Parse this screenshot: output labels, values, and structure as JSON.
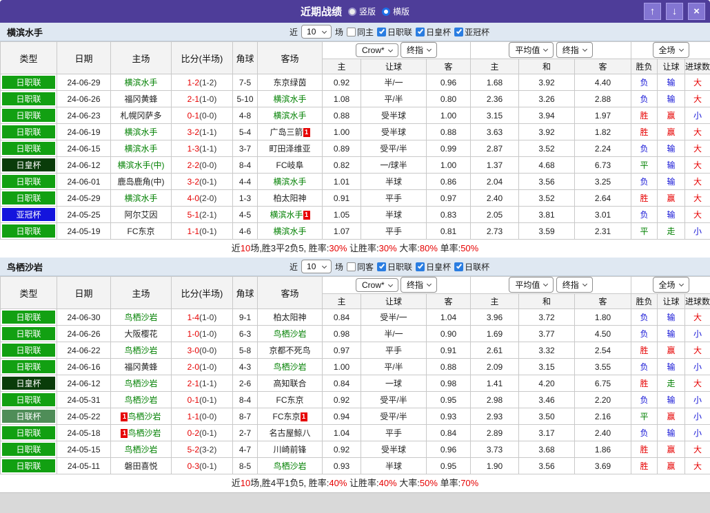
{
  "titlebar": {
    "title": "近期战绩",
    "radios": [
      {
        "label": "竖版",
        "selected": false
      },
      {
        "label": "横版",
        "selected": true
      }
    ],
    "buttons": {
      "up": "↑",
      "down": "↓",
      "close": "×"
    }
  },
  "labels": {
    "near": "近",
    "games": "场"
  },
  "badge_label": "1",
  "columns": {
    "main": [
      "类型",
      "日期",
      "主场",
      "比分(半场)",
      "角球",
      "客场"
    ],
    "g1": [
      "Crow*",
      "终指"
    ],
    "g2": [
      "平均值",
      "终指"
    ],
    "g3": [
      "全场"
    ],
    "sub": [
      "主",
      "让球",
      "客",
      "主",
      "和",
      "客",
      "胜负",
      "让球",
      "进球数"
    ]
  },
  "type_colors": {
    "日职联": "#12a012",
    "日皇杯": "#0a3c0a",
    "亚冠杯": "#1414dd",
    "日联杯": "#4f8d58"
  },
  "result_colors": {
    "胜": "#e60000",
    "赢": "#e60000",
    "大": "#e60000",
    "平": "#008000",
    "走": "#008000",
    "负": "#1414d6",
    "输": "#1414d6",
    "小": "#1414d6"
  },
  "sections": [
    {
      "team": "横滨水手",
      "filter": {
        "count": "10",
        "same_label": "同主",
        "same_checked": false,
        "leagues": [
          {
            "label": "日职联",
            "checked": true
          },
          {
            "label": "日皇杯",
            "checked": true
          },
          {
            "label": "亚冠杯",
            "checked": true
          }
        ]
      },
      "rows": [
        {
          "type": "日职联",
          "date": "24-06-29",
          "home": {
            "n": "横滨水手",
            "g": true
          },
          "score": "1-2",
          "half": "(1-2)",
          "corner": "7-5",
          "away": {
            "n": "东京绿茵"
          },
          "o1": [
            "0.92",
            "半/一",
            "0.96"
          ],
          "o2": [
            "1.68",
            "3.92",
            "4.40"
          ],
          "res": [
            "负",
            "输",
            "大"
          ]
        },
        {
          "type": "日职联",
          "date": "24-06-26",
          "home": {
            "n": "福冈黄蜂"
          },
          "score": "2-1",
          "half": "(1-0)",
          "corner": "5-10",
          "away": {
            "n": "横滨水手",
            "g": true
          },
          "o1": [
            "1.08",
            "平/半",
            "0.80"
          ],
          "o2": [
            "2.36",
            "3.26",
            "2.88"
          ],
          "res": [
            "负",
            "输",
            "大"
          ]
        },
        {
          "type": "日职联",
          "date": "24-06-23",
          "home": {
            "n": "札幌冈萨多"
          },
          "score": "0-1",
          "half": "(0-0)",
          "corner": "4-8",
          "away": {
            "n": "横滨水手",
            "g": true
          },
          "o1": [
            "0.88",
            "受半球",
            "1.00"
          ],
          "o2": [
            "3.15",
            "3.94",
            "1.97"
          ],
          "res": [
            "胜",
            "赢",
            "小"
          ]
        },
        {
          "type": "日职联",
          "date": "24-06-19",
          "home": {
            "n": "横滨水手",
            "g": true
          },
          "score": "3-2",
          "half": "(1-1)",
          "corner": "5-4",
          "away": {
            "n": "广岛三箭",
            "badge": "after"
          },
          "o1": [
            "1.00",
            "受半球",
            "0.88"
          ],
          "o2": [
            "3.63",
            "3.92",
            "1.82"
          ],
          "res": [
            "胜",
            "赢",
            "大"
          ]
        },
        {
          "type": "日职联",
          "date": "24-06-15",
          "home": {
            "n": "横滨水手",
            "g": true
          },
          "score": "1-3",
          "half": "(1-1)",
          "corner": "3-7",
          "away": {
            "n": "町田泽维亚"
          },
          "o1": [
            "0.89",
            "受平/半",
            "0.99"
          ],
          "o2": [
            "2.87",
            "3.52",
            "2.24"
          ],
          "res": [
            "负",
            "输",
            "大"
          ]
        },
        {
          "type": "日皇杯",
          "date": "24-06-12",
          "home": {
            "n": "横滨水手(中)",
            "g": true
          },
          "score": "2-2",
          "half": "(0-0)",
          "corner": "8-4",
          "away": {
            "n": "FC岐阜"
          },
          "o1": [
            "0.82",
            "一/球半",
            "1.00"
          ],
          "o2": [
            "1.37",
            "4.68",
            "6.73"
          ],
          "res": [
            "平",
            "输",
            "大"
          ]
        },
        {
          "type": "日职联",
          "date": "24-06-01",
          "home": {
            "n": "鹿岛鹿角(中)"
          },
          "score": "3-2",
          "half": "(0-1)",
          "corner": "4-4",
          "away": {
            "n": "横滨水手",
            "g": true
          },
          "o1": [
            "1.01",
            "半球",
            "0.86"
          ],
          "o2": [
            "2.04",
            "3.56",
            "3.25"
          ],
          "res": [
            "负",
            "输",
            "大"
          ]
        },
        {
          "type": "日职联",
          "date": "24-05-29",
          "home": {
            "n": "横滨水手",
            "g": true
          },
          "score": "4-0",
          "half": "(2-0)",
          "corner": "1-3",
          "away": {
            "n": "柏太阳神"
          },
          "o1": [
            "0.91",
            "平手",
            "0.97"
          ],
          "o2": [
            "2.40",
            "3.52",
            "2.64"
          ],
          "res": [
            "胜",
            "赢",
            "大"
          ]
        },
        {
          "type": "亚冠杯",
          "date": "24-05-25",
          "home": {
            "n": "阿尔艾因"
          },
          "score": "5-1",
          "half": "(2-1)",
          "corner": "4-5",
          "away": {
            "n": "横滨水手",
            "g": true,
            "badge": "after"
          },
          "o1": [
            "1.05",
            "半球",
            "0.83"
          ],
          "o2": [
            "2.05",
            "3.81",
            "3.01"
          ],
          "res": [
            "负",
            "输",
            "大"
          ]
        },
        {
          "type": "日职联",
          "date": "24-05-19",
          "home": {
            "n": "FC东京"
          },
          "score": "1-1",
          "half": "(0-1)",
          "corner": "4-6",
          "away": {
            "n": "横滨水手",
            "g": true
          },
          "o1": [
            "1.07",
            "平手",
            "0.81"
          ],
          "o2": [
            "2.73",
            "3.59",
            "2.31"
          ],
          "res": [
            "平",
            "走",
            "小"
          ]
        }
      ],
      "summary": [
        {
          "t": "近"
        },
        {
          "t": "10",
          "r": true
        },
        {
          "t": "场,胜3平2负5, 胜率:"
        },
        {
          "t": "30%",
          "r": true
        },
        {
          "t": " 让胜率:"
        },
        {
          "t": "30%",
          "r": true
        },
        {
          "t": " 大率:"
        },
        {
          "t": "80%",
          "r": true
        },
        {
          "t": " 单率:"
        },
        {
          "t": "50%",
          "r": true
        }
      ]
    },
    {
      "team": "鸟栖沙岩",
      "filter": {
        "count": "10",
        "same_label": "同客",
        "same_checked": false,
        "leagues": [
          {
            "label": "日职联",
            "checked": true
          },
          {
            "label": "日皇杯",
            "checked": true
          },
          {
            "label": "日联杯",
            "checked": true
          }
        ]
      },
      "rows": [
        {
          "type": "日职联",
          "date": "24-06-30",
          "home": {
            "n": "鸟栖沙岩",
            "g": true
          },
          "score": "1-4",
          "half": "(1-0)",
          "corner": "9-1",
          "away": {
            "n": "柏太阳神"
          },
          "o1": [
            "0.84",
            "受半/一",
            "1.04"
          ],
          "o2": [
            "3.96",
            "3.72",
            "1.80"
          ],
          "res": [
            "负",
            "输",
            "大"
          ]
        },
        {
          "type": "日职联",
          "date": "24-06-26",
          "home": {
            "n": "大阪樱花"
          },
          "score": "1-0",
          "half": "(1-0)",
          "corner": "6-3",
          "away": {
            "n": "鸟栖沙岩",
            "g": true
          },
          "o1": [
            "0.98",
            "半/一",
            "0.90"
          ],
          "o2": [
            "1.69",
            "3.77",
            "4.50"
          ],
          "res": [
            "负",
            "输",
            "小"
          ]
        },
        {
          "type": "日职联",
          "date": "24-06-22",
          "home": {
            "n": "鸟栖沙岩",
            "g": true
          },
          "score": "3-0",
          "half": "(0-0)",
          "corner": "5-8",
          "away": {
            "n": "京都不死鸟"
          },
          "o1": [
            "0.97",
            "平手",
            "0.91"
          ],
          "o2": [
            "2.61",
            "3.32",
            "2.54"
          ],
          "res": [
            "胜",
            "赢",
            "大"
          ]
        },
        {
          "type": "日职联",
          "date": "24-06-16",
          "home": {
            "n": "福冈黄蜂"
          },
          "score": "2-0",
          "half": "(1-0)",
          "corner": "4-3",
          "away": {
            "n": "鸟栖沙岩",
            "g": true
          },
          "o1": [
            "1.00",
            "平/半",
            "0.88"
          ],
          "o2": [
            "2.09",
            "3.15",
            "3.55"
          ],
          "res": [
            "负",
            "输",
            "小"
          ]
        },
        {
          "type": "日皇杯",
          "date": "24-06-12",
          "home": {
            "n": "鸟栖沙岩",
            "g": true
          },
          "score": "2-1",
          "half": "(1-1)",
          "corner": "2-6",
          "away": {
            "n": "高知联合"
          },
          "o1": [
            "0.84",
            "一球",
            "0.98"
          ],
          "o2": [
            "1.41",
            "4.20",
            "6.75"
          ],
          "res": [
            "胜",
            "走",
            "大"
          ]
        },
        {
          "type": "日职联",
          "date": "24-05-31",
          "home": {
            "n": "鸟栖沙岩",
            "g": true
          },
          "score": "0-1",
          "half": "(0-1)",
          "corner": "8-4",
          "away": {
            "n": "FC东京"
          },
          "o1": [
            "0.92",
            "受平/半",
            "0.95"
          ],
          "o2": [
            "2.98",
            "3.46",
            "2.20"
          ],
          "res": [
            "负",
            "输",
            "小"
          ]
        },
        {
          "type": "日联杯",
          "date": "24-05-22",
          "home": {
            "n": "鸟栖沙岩",
            "g": true,
            "badge": "before"
          },
          "score": "1-1",
          "half": "(0-0)",
          "corner": "8-7",
          "away": {
            "n": "FC东京",
            "badge": "after"
          },
          "o1": [
            "0.94",
            "受平/半",
            "0.93"
          ],
          "o2": [
            "2.93",
            "3.50",
            "2.16"
          ],
          "res": [
            "平",
            "赢",
            "小"
          ]
        },
        {
          "type": "日职联",
          "date": "24-05-18",
          "home": {
            "n": "鸟栖沙岩",
            "g": true,
            "badge": "before"
          },
          "score": "0-2",
          "half": "(0-1)",
          "corner": "2-7",
          "away": {
            "n": "名古屋鲸八"
          },
          "o1": [
            "1.04",
            "平手",
            "0.84"
          ],
          "o2": [
            "2.89",
            "3.17",
            "2.40"
          ],
          "res": [
            "负",
            "输",
            "小"
          ]
        },
        {
          "type": "日职联",
          "date": "24-05-15",
          "home": {
            "n": "鸟栖沙岩",
            "g": true
          },
          "score": "5-2",
          "half": "(3-2)",
          "corner": "4-7",
          "away": {
            "n": "川崎前锋"
          },
          "o1": [
            "0.92",
            "受半球",
            "0.96"
          ],
          "o2": [
            "3.73",
            "3.68",
            "1.86"
          ],
          "res": [
            "胜",
            "赢",
            "大"
          ]
        },
        {
          "type": "日职联",
          "date": "24-05-11",
          "home": {
            "n": "磐田喜悦"
          },
          "score": "0-3",
          "half": "(0-1)",
          "corner": "8-5",
          "away": {
            "n": "鸟栖沙岩",
            "g": true
          },
          "o1": [
            "0.93",
            "半球",
            "0.95"
          ],
          "o2": [
            "1.90",
            "3.56",
            "3.69"
          ],
          "res": [
            "胜",
            "赢",
            "大"
          ]
        }
      ],
      "summary": [
        {
          "t": "近"
        },
        {
          "t": "10",
          "r": true
        },
        {
          "t": "场,胜4平1负5, 胜率:"
        },
        {
          "t": "40%",
          "r": true
        },
        {
          "t": " 让胜率:"
        },
        {
          "t": "40%",
          "r": true
        },
        {
          "t": " 大率:"
        },
        {
          "t": "50%",
          "r": true
        },
        {
          "t": " 单率:"
        },
        {
          "t": "70%",
          "r": true
        }
      ]
    }
  ]
}
